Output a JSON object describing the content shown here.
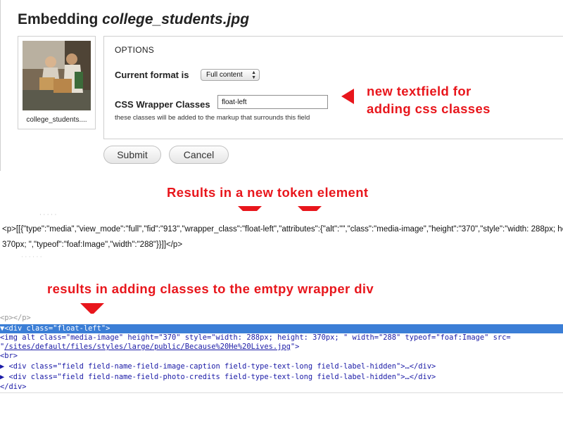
{
  "dialog": {
    "title_prefix": "Embedding ",
    "title_filename": "college_students.jpg",
    "thumbnail_caption": "college_students....",
    "options": {
      "heading": "OPTIONS",
      "format_label": "Current format is",
      "format_value": "Full content",
      "css_label": "CSS Wrapper Classes",
      "css_value": "float-left",
      "css_help": "these classes will be added to the markup that surrounds this field"
    },
    "buttons": {
      "submit": "Submit",
      "cancel": "Cancel"
    }
  },
  "annotations": {
    "textfield_line1": "new textfield for",
    "textfield_line2": "adding css classes",
    "token": "Results in a new token element",
    "wrapper": "results in adding classes to the emtpy wrapper div"
  },
  "token": {
    "line1": "<p>[[{\"type\":\"media\",\"view_mode\":\"full\",\"fid\":\"913\",\"wrapper_class\":\"float-left\",\"attributes\":{\"alt\":\"\",\"class\":\"media-image\",\"height\":\"370\",\"style\":\"width: 288px; height:",
    "line2": "370px; \",\"typeof\":\"foaf:Image\",\"width\":\"288\"}}]]</p>"
  },
  "inspector": {
    "line0": "  <p></p>",
    "line1": "▼<div class=\"float-left\">",
    "line2": "    <img alt class=\"media-image\" height=\"370\" style=\"width: 288px; height: 370px; \" width=\"288\" typeof=\"foaf:Image\" src=",
    "line3_link": "/sites/default/files/styles/large/public/Because%20He%20Lives.jpg",
    "line3_quote_open": "    \"",
    "line3_end": "\">",
    "line4": "    <br>",
    "line5": " ▶ <div class=\"field field-name-field-image-caption field-type-text-long field-label-hidden\">…</div>",
    "line6": " ▶ <div class=\"field field-name-field-photo-credits field-type-text-long field-label-hidden\">…</div>",
    "line7": "  </div>"
  },
  "colors": {
    "annotation_red": "#e8161c",
    "selected_row": "#3b7ed6",
    "markup_blue": "#1a1aa6"
  }
}
